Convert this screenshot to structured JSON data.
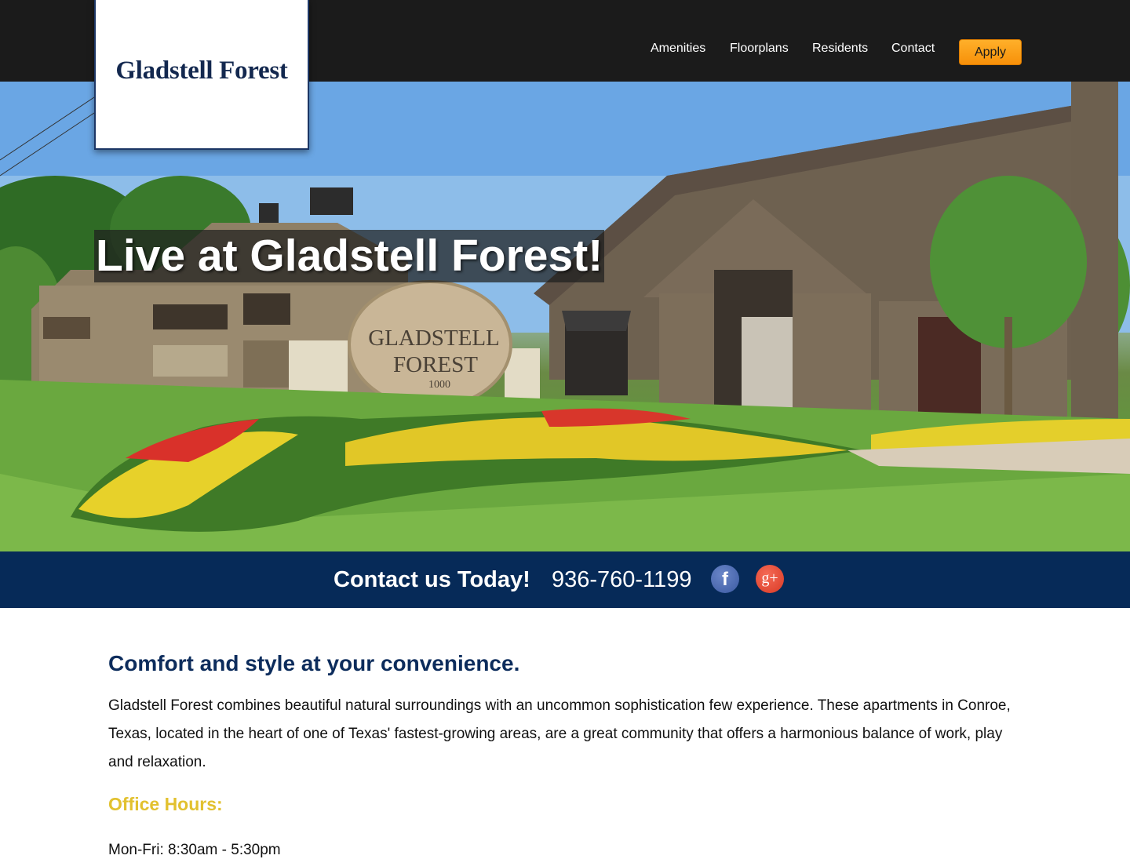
{
  "brand": {
    "logo_text": "Gladstell Forest"
  },
  "nav": {
    "items": [
      {
        "label": "Amenities"
      },
      {
        "label": "Floorplans"
      },
      {
        "label": "Residents"
      },
      {
        "label": "Contact"
      }
    ],
    "apply_label": "Apply"
  },
  "hero": {
    "title": "Live at Gladstell Forest!",
    "sign_line1": "GLADSTELL",
    "sign_line2": "FOREST",
    "sign_number": "1000"
  },
  "contact": {
    "label": "Contact us Today!",
    "phone": "936-760-1199",
    "facebook_glyph": "f",
    "googleplus_glyph": "g+"
  },
  "content": {
    "headline": "Comfort and style at your convenience.",
    "intro": "Gladstell Forest combines beautiful natural surroundings with an uncommon sophistication few experience. These apartments in Conroe, Texas, located in the heart of one of Texas' fastest-growing areas, are a great community that offers a harmonious balance of work, play and relaxation.",
    "hours_title": "Office Hours:",
    "hours_line": "Mon-Fri: 8:30am - 5:30pm"
  },
  "colors": {
    "topbar": "#1b1b1b",
    "accent_orange": "#f79009",
    "navy_band": "#062a58",
    "headline_navy": "#0c2c5c",
    "hours_gold": "#e2c12f"
  }
}
